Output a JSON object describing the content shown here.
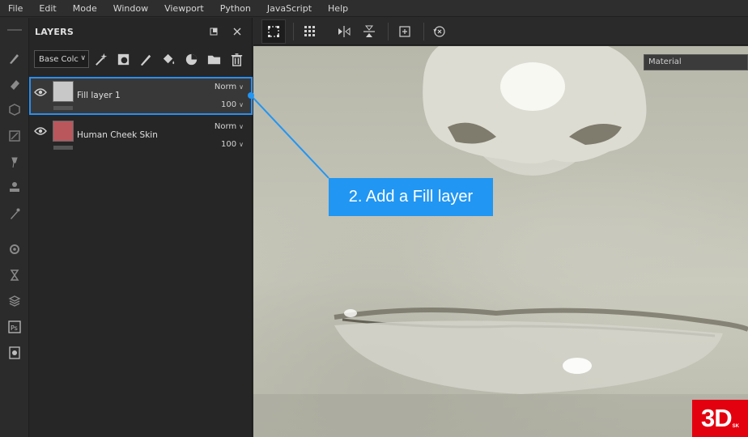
{
  "menu": [
    "File",
    "Edit",
    "Mode",
    "Window",
    "Viewport",
    "Python",
    "JavaScript",
    "Help"
  ],
  "layers_panel": {
    "title": "LAYERS",
    "channel_select": "Base Colc",
    "layers": [
      {
        "name": "Fill layer 1",
        "blend": "Norm",
        "opacity": "100",
        "selected": true,
        "thumb_color": "#c8c8c8"
      },
      {
        "name": "Human Cheek Skin",
        "blend": "Norm",
        "opacity": "100",
        "selected": false,
        "thumb_color": "#b9575d"
      }
    ]
  },
  "viewport": {
    "material_label": "Material"
  },
  "callout": {
    "text": "2. Add a Fill layer",
    "color": "#2196f3"
  },
  "logo": {
    "text": "3D",
    "sub": "SK"
  },
  "colors": {
    "accent": "#2b8eef",
    "logo_red": "#e3000f"
  }
}
